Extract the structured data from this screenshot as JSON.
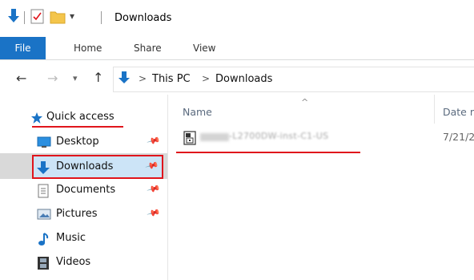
{
  "window": {
    "title": "Downloads",
    "quick_access_dropdown_glyph": "▾"
  },
  "ribbon": {
    "tabs": [
      "File",
      "Home",
      "Share",
      "View"
    ]
  },
  "address": {
    "back_glyph": "←",
    "forward_glyph": "→",
    "recent_glyph": "▾",
    "up_glyph": "↑",
    "path": [
      "This PC",
      "Downloads"
    ],
    "separator": ">"
  },
  "sidebar": {
    "header": "Quick access",
    "items": [
      {
        "label": "Desktop",
        "icon": "desktop-icon",
        "pinned": true
      },
      {
        "label": "Downloads",
        "icon": "downloads-icon",
        "pinned": true,
        "selected": true
      },
      {
        "label": "Documents",
        "icon": "documents-icon",
        "pinned": true
      },
      {
        "label": "Pictures",
        "icon": "pictures-icon",
        "pinned": true
      },
      {
        "label": "Music",
        "icon": "music-icon",
        "pinned": false
      },
      {
        "label": "Videos",
        "icon": "videos-icon",
        "pinned": false
      }
    ]
  },
  "columns": {
    "name": "Name",
    "sort_glyph": "^",
    "date": "Date m"
  },
  "files": [
    {
      "name": "-L2700DW-inst-C1-US",
      "date": "7/21/2",
      "icon": "zip-archive-icon"
    }
  ],
  "colors": {
    "accent": "#1a73c6",
    "highlight_red": "#e0151c",
    "selected_bg": "#cce4f7"
  }
}
